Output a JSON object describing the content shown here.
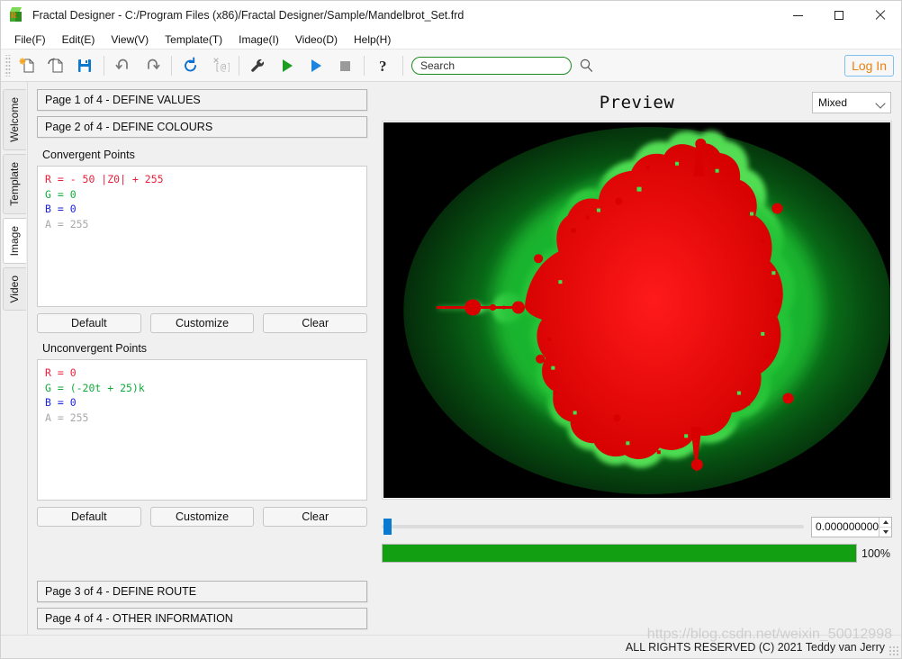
{
  "window": {
    "title": "Fractal Designer - C:/Program Files (x86)/Fractal Designer/Sample/Mandelbrot_Set.frd",
    "icon": "green-cube-r-icon",
    "controls": {
      "minimize": "minimize-icon",
      "maximize": "maximize-icon",
      "close": "close-icon"
    }
  },
  "menubar": {
    "items": [
      {
        "label": "File(F)"
      },
      {
        "label": "Edit(E)"
      },
      {
        "label": "View(V)"
      },
      {
        "label": "Template(T)"
      },
      {
        "label": "Image(I)"
      },
      {
        "label": "Video(D)"
      },
      {
        "label": "Help(H)"
      }
    ]
  },
  "toolbar": {
    "buttons": [
      {
        "name": "new-file-icon"
      },
      {
        "name": "open-file-icon"
      },
      {
        "name": "save-icon"
      },
      {
        "name": "undo-icon"
      },
      {
        "name": "redo-icon"
      },
      {
        "name": "refresh-icon"
      },
      {
        "name": "clear-variables-icon"
      },
      {
        "name": "settings-wrench-icon"
      },
      {
        "name": "run-green-icon"
      },
      {
        "name": "play-blue-icon"
      },
      {
        "name": "stop-icon"
      },
      {
        "name": "help-question-icon"
      }
    ],
    "search": {
      "value": "",
      "placeholder": "Search",
      "go_icon": "magnifier-icon"
    },
    "login_label": "Log In",
    "accent_green": "#1e8b1e",
    "accent_orange": "#e8820c",
    "accent_blue": "#7ec1ef"
  },
  "sidebar": {
    "tabs": [
      {
        "label": "Welcome",
        "active": false
      },
      {
        "label": "Template",
        "active": false
      },
      {
        "label": "Image",
        "active": true
      },
      {
        "label": "Video",
        "active": false
      }
    ]
  },
  "left_panel": {
    "page1_header": "Page 1 of 4 - DEFINE VALUES",
    "page2_header": "Page 2 of 4 - DEFINE COLOURS",
    "page3_header": "Page 3 of 4 - DEFINE ROUTE",
    "page4_header": "Page 4 of 4 - OTHER INFORMATION",
    "convergent": {
      "label": "Convergent Points",
      "code": {
        "r": "R =  - 50 |Z0| + 255",
        "g": "G = 0",
        "b": "B = 0",
        "a": "A = 255"
      },
      "buttons": {
        "default": "Default",
        "customize": "Customize",
        "clear": "Clear"
      }
    },
    "unconvergent": {
      "label": "Unconvergent Points",
      "code": {
        "r": "R = 0",
        "g": "G = (-20t + 25)k",
        "b": "B = 0",
        "a": "A = 255"
      },
      "buttons": {
        "default": "Default",
        "customize": "Customize",
        "clear": "Clear"
      }
    },
    "code_colors": {
      "r": "#e8213b",
      "g": "#12aa3c",
      "b": "#1a25dd",
      "a": "#a8a8a8"
    }
  },
  "preview": {
    "title": "Preview",
    "mode_selected": "Mixed",
    "mode_chevron": "chevron-down-icon",
    "slider_value": "0.000000000",
    "slider_position_pct": 0,
    "progress_value": 100,
    "progress_label": "100%",
    "progress_color": "#12a012",
    "image": {
      "name": "mandelbrot-set-fractal",
      "set_color": "#e00000",
      "background_color": "#000000",
      "band_colors": [
        "#000000",
        "#05300b",
        "#064a10",
        "#0a6b18",
        "#0f8b20",
        "#17ab28",
        "#27cb38",
        "#55e060",
        "#8cf08c"
      ]
    }
  },
  "statusbar": {
    "text": "ALL RIGHTS RESERVED (C) 2021 Teddy van Jerry",
    "watermark": "https://blog.csdn.net/weixin_50012998"
  }
}
